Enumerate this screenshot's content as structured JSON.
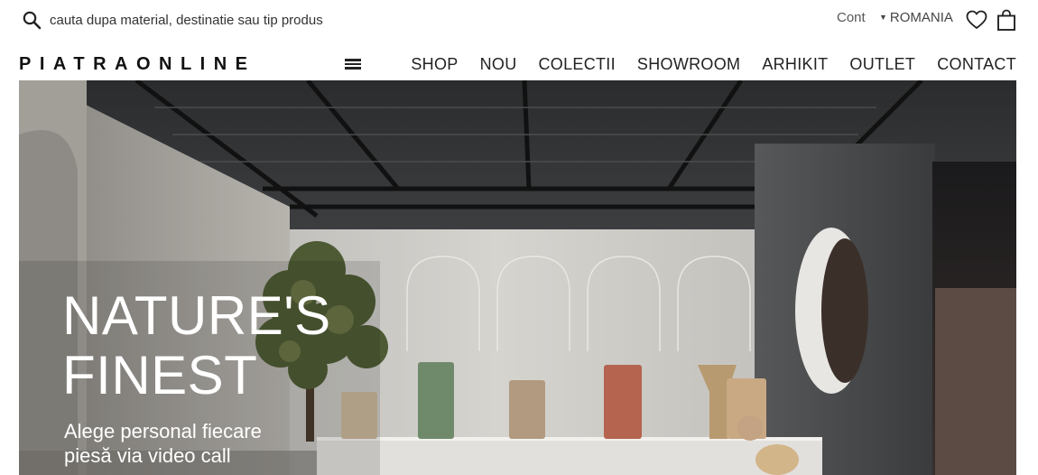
{
  "header": {
    "search": {
      "placeholder": "cauta dupa material, destinatie sau tip produs",
      "value": ""
    },
    "account_label": "Cont",
    "country_label": "ROMANIA",
    "icons": [
      "search-icon",
      "heart-icon",
      "bag-icon",
      "caret-down-icon",
      "hamburger-icon"
    ]
  },
  "navbar": {
    "logo": "PIATRAONLINE",
    "menu": [
      "SHOP",
      "NOU",
      "COLECTII",
      "SHOWROOM",
      "ARHIKIT",
      "OUTLET",
      "CONTACT"
    ]
  },
  "hero": {
    "headline_lines": [
      "NATURE'S",
      "FINEST"
    ],
    "subtitle_lines": [
      "Alege personal fiecare",
      "piesă via video call"
    ]
  },
  "colors": {
    "text": "#222222",
    "hero_text": "#ffffff",
    "background": "#ffffff"
  }
}
